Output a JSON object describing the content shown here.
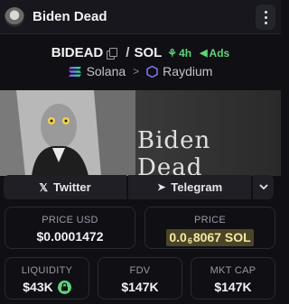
{
  "header": {
    "title": "Biden Dead"
  },
  "pair": {
    "base": "BIDEAD",
    "quote": "SOL",
    "age": "4h",
    "ads_label": "Ads"
  },
  "chain": {
    "network": "Solana",
    "dex": "Raydium"
  },
  "banner": {
    "text": "Biden Dead"
  },
  "links": {
    "twitter": "Twitter",
    "telegram": "Telegram"
  },
  "stats": {
    "price_usd": {
      "label": "PRICE USD",
      "value": "$0.0001472"
    },
    "price_native": {
      "label": "PRICE",
      "prefix": "0.0",
      "zeros": "6",
      "digits": "8067",
      "unit": "SOL"
    },
    "liquidity": {
      "label": "LIQUIDITY",
      "value": "$43K"
    },
    "fdv": {
      "label": "FDV",
      "value": "$147K"
    },
    "mcap": {
      "label": "MKT CAP",
      "value": "$147K"
    }
  },
  "colors": {
    "accent_green": "#5fd37a",
    "price_highlight": "#4b4527"
  }
}
